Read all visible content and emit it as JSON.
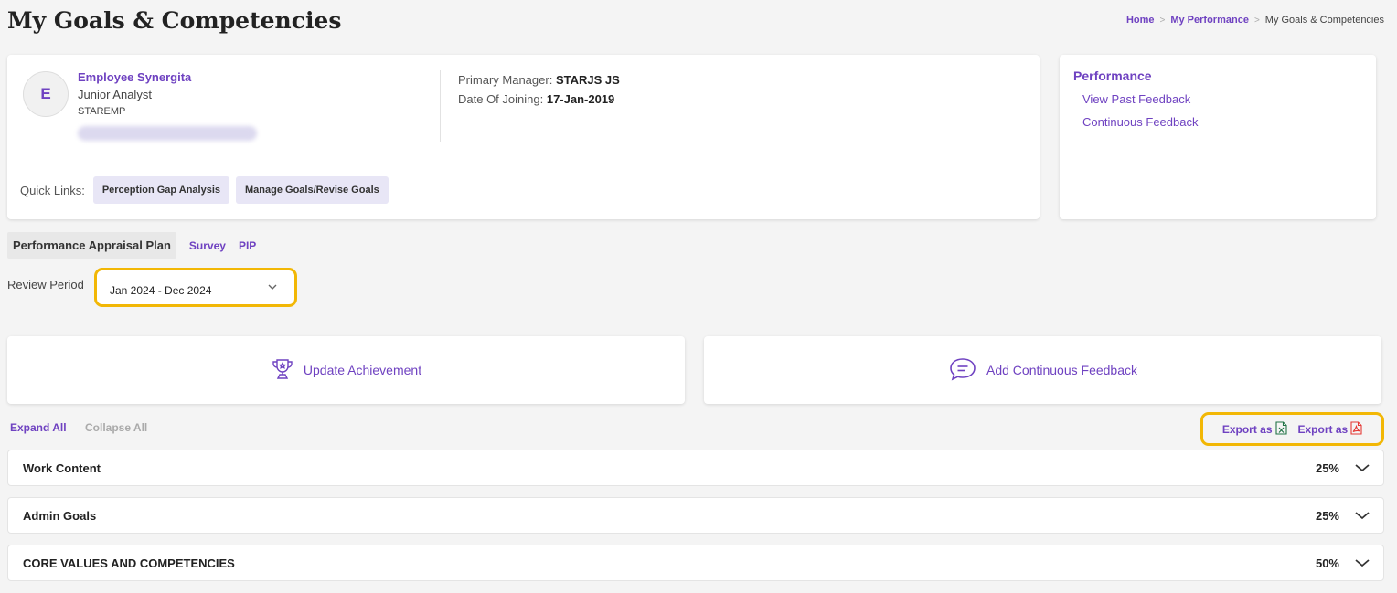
{
  "page": {
    "title": "My Goals & Competencies"
  },
  "breadcrumb": {
    "home": "Home",
    "section": "My Performance",
    "current": "My Goals & Competencies"
  },
  "profile": {
    "initial": "E",
    "name": "Employee Synergita",
    "role": "Junior Analyst",
    "code": "STAREMP",
    "primary_manager_label": "Primary Manager:",
    "primary_manager": "STARJS JS",
    "doj_label": "Date Of Joining:",
    "doj": "17-Jan-2019"
  },
  "quick_links": {
    "label": "Quick Links:",
    "items": [
      "Perception Gap Analysis",
      "Manage Goals/Revise Goals"
    ]
  },
  "performance_panel": {
    "title": "Performance",
    "links": [
      "View Past Feedback",
      "Continuous Feedback"
    ]
  },
  "tabs": [
    "Performance Appraisal Plan",
    "Survey",
    "PIP"
  ],
  "review_period": {
    "label": "Review Period",
    "value": "Jan 2024 - Dec 2024"
  },
  "actions": {
    "update_achievement": "Update Achievement",
    "add_feedback": "Add Continuous Feedback"
  },
  "controls": {
    "expand_all": "Expand All",
    "collapse_all": "Collapse All"
  },
  "export": {
    "excel_label": "Export as",
    "pdf_label": "Export as"
  },
  "sections": [
    {
      "title": "Work Content",
      "weight": "25%"
    },
    {
      "title": "Admin Goals",
      "weight": "25%"
    },
    {
      "title": "CORE VALUES AND COMPETENCIES",
      "weight": "50%"
    }
  ],
  "icons": {
    "trophy": "trophy-icon",
    "feedback": "chat-feedback-icon",
    "excel": "excel-file-icon",
    "pdf": "pdf-file-icon",
    "chevron": "chevron-down-icon"
  },
  "colors": {
    "accent": "#6f42c1",
    "highlight": "#f2b705",
    "chip_bg": "#e8e6f6",
    "excel": "#217346",
    "pdf": "#e53935"
  }
}
